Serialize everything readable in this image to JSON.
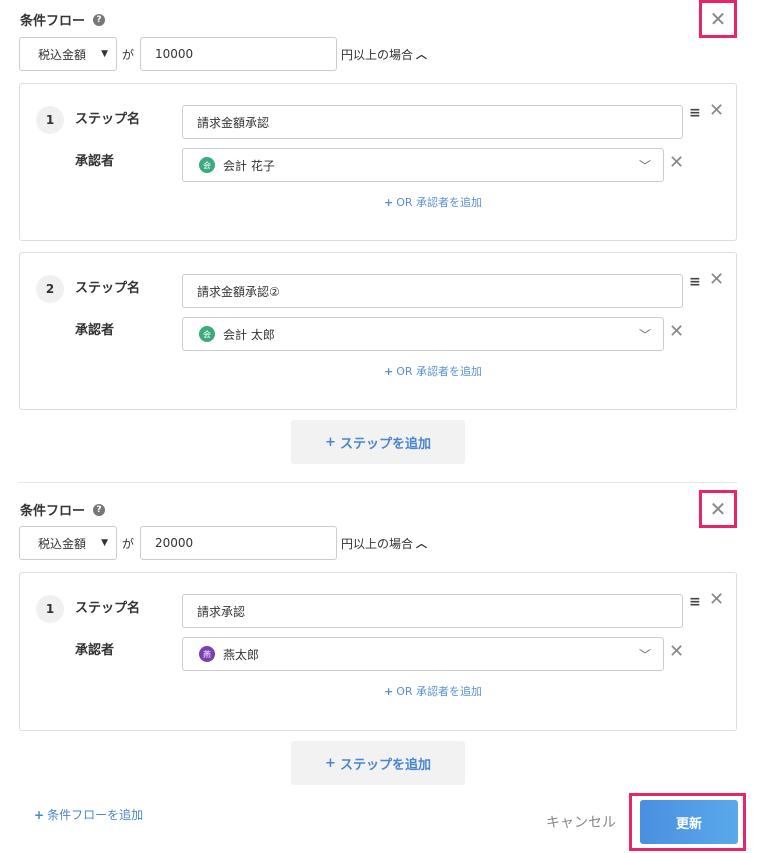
{
  "flows": [
    {
      "title": "条件フロー",
      "condition": {
        "field": "税込金額",
        "ga": "が",
        "amount": "10000",
        "suffix": "円以上の場合"
      },
      "steps": [
        {
          "number": "1",
          "name_label": "ステップ名",
          "name_value": "請求金額承認",
          "approver_label": "承認者",
          "approver_avatar": "会",
          "approver_name": "会計 花子",
          "approver_color": "#3daa7d",
          "or_add": "OR 承認者を追加"
        },
        {
          "number": "2",
          "name_label": "ステップ名",
          "name_value": "請求金額承認②",
          "approver_label": "承認者",
          "approver_avatar": "会",
          "approver_name": "会計 太郎",
          "approver_color": "#3daa7d",
          "or_add": "OR 承認者を追加"
        }
      ],
      "add_step": "ステップを追加"
    },
    {
      "title": "条件フロー",
      "condition": {
        "field": "税込金額",
        "ga": "が",
        "amount": "20000",
        "suffix": "円以上の場合"
      },
      "steps": [
        {
          "number": "1",
          "name_label": "ステップ名",
          "name_value": "請求承認",
          "approver_label": "承認者",
          "approver_avatar": "燕",
          "approver_name": "燕太郎",
          "approver_color": "#7b3fb5",
          "or_add": "OR 承認者を追加"
        }
      ],
      "add_step": "ステップを追加"
    }
  ],
  "footer": {
    "add_flow": "条件フローを追加",
    "cancel": "キャンセル",
    "update": "更新"
  },
  "colors": {
    "highlight": "#e8256b",
    "link": "#4a86cc",
    "primary": "#4a8fe0"
  },
  "icons": {
    "help": "question-circle-icon",
    "close": "close-icon",
    "menu": "hamburger-icon",
    "chevron": "chevron-down-icon",
    "plus": "plus-icon"
  }
}
